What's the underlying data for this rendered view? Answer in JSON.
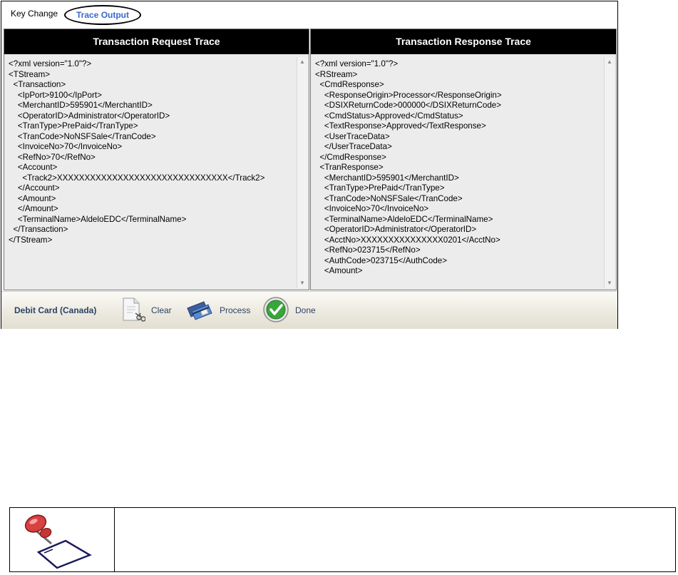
{
  "tabs": {
    "key_change": "Key Change",
    "trace_output": "Trace Output"
  },
  "request_pane": {
    "title": "Transaction Request Trace",
    "lines": [
      "<?xml version=\"1.0\"?>",
      "<TStream>",
      "  <Transaction>",
      "    <IpPort>9100</IpPort>",
      "    <MerchantID>595901</MerchantID>",
      "    <OperatorID>Administrator</OperatorID>",
      "    <TranType>PrePaid</TranType>",
      "    <TranCode>NoNSFSale</TranCode>",
      "    <InvoiceNo>70</InvoiceNo>",
      "    <RefNo>70</RefNo>",
      "    <Account>",
      "      <Track2>XXXXXXXXXXXXXXXXXXXXXXXXXXXXXXX</Track2>",
      "    </Account>",
      "    <Amount>",
      "    </Amount>",
      "    <TerminalName>AldeloEDC</TerminalName>",
      "  </Transaction>",
      "</TStream>"
    ]
  },
  "response_pane": {
    "title": "Transaction Response Trace",
    "lines": [
      "<?xml version=\"1.0\"?>",
      "<RStream>",
      "  <CmdResponse>",
      "    <ResponseOrigin>Processor</ResponseOrigin>",
      "    <DSIXReturnCode>000000</DSIXReturnCode>",
      "    <CmdStatus>Approved</CmdStatus>",
      "    <TextResponse>Approved</TextResponse>",
      "    <UserTraceData>",
      "    </UserTraceData>",
      "  </CmdResponse>",
      "  <TranResponse>",
      "    <MerchantID>595901</MerchantID>",
      "    <TranType>PrePaid</TranType>",
      "    <TranCode>NoNSFSale</TranCode>",
      "    <InvoiceNo>70</InvoiceNo>",
      "    <TerminalName>AldeloEDC</TerminalName>",
      "    <OperatorID>Administrator</OperatorID>",
      "    <AcctNo>XXXXXXXXXXXXXXX0201</AcctNo>",
      "    <RefNo>023715</RefNo>",
      "    <AuthCode>023715</AuthCode>",
      "    <Amount>"
    ]
  },
  "footer": {
    "title": "Debit Card (Canada)",
    "clear_label": "Clear",
    "process_label": "Process",
    "done_label": "Done"
  },
  "colors": {
    "header_bg": "#000000",
    "tab_active": "#3a69c8",
    "footer_text": "#2a4366",
    "done_green": "#3aa53a"
  }
}
